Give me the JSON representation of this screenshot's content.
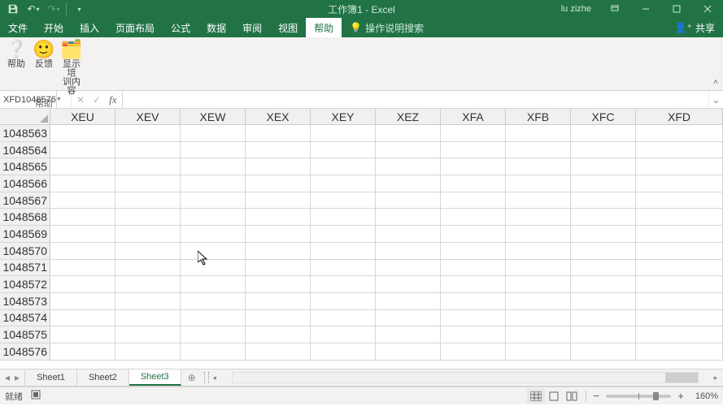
{
  "titlebar": {
    "title": "工作簿1 - Excel",
    "username": "lu zizhe"
  },
  "ribbon": {
    "tabs": {
      "file": "文件",
      "home": "开始",
      "insert": "插入",
      "page_layout": "页面布局",
      "formulas": "公式",
      "data": "数据",
      "review": "审阅",
      "view": "视图",
      "help": "帮助"
    },
    "tellme": "操作说明搜索",
    "share": "共享"
  },
  "ribbon_group": {
    "help_btn1": "帮助",
    "help_btn2": "反馈",
    "help_btn3_l1": "显示培",
    "help_btn3_l2": "训内容",
    "group_label": "帮助"
  },
  "namebox": "XFD1048576",
  "formula_fx": "fx",
  "columns": [
    "XEU",
    "XEV",
    "XEW",
    "XEX",
    "XEY",
    "XEZ",
    "XFA",
    "XFB",
    "XFC",
    "XFD"
  ],
  "rows": [
    "1048563",
    "1048564",
    "1048565",
    "1048566",
    "1048567",
    "1048568",
    "1048569",
    "1048570",
    "1048571",
    "1048572",
    "1048573",
    "1048574",
    "1048575",
    "1048576"
  ],
  "sheets": {
    "s1": "Sheet1",
    "s2": "Sheet2",
    "s3": "Sheet3"
  },
  "status": {
    "ready": "就绪",
    "zoom": "160%"
  }
}
